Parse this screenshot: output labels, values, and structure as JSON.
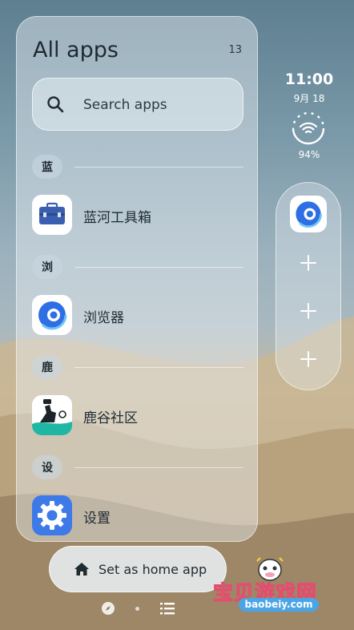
{
  "panel": {
    "title": "All apps",
    "count": "13"
  },
  "search": {
    "label": "Search apps"
  },
  "sections": [
    {
      "letter": "蓝",
      "app": "蓝河工具箱"
    },
    {
      "letter": "浏",
      "app": "浏览器"
    },
    {
      "letter": "鹿",
      "app": "鹿谷社区"
    },
    {
      "letter": "设",
      "app": "设置"
    }
  ],
  "status": {
    "time": "11:00",
    "date": "9月 18",
    "battery": "94%"
  },
  "bottom": {
    "home_label": "Set as home app"
  },
  "watermark": {
    "title": "宝贝游戏网",
    "url": "baobeiy.com"
  },
  "colors": {
    "accent_blue": "#2f6fe4",
    "toolbox_blue": "#3a5fb0",
    "watermark_yellow": "#ffd52e"
  }
}
